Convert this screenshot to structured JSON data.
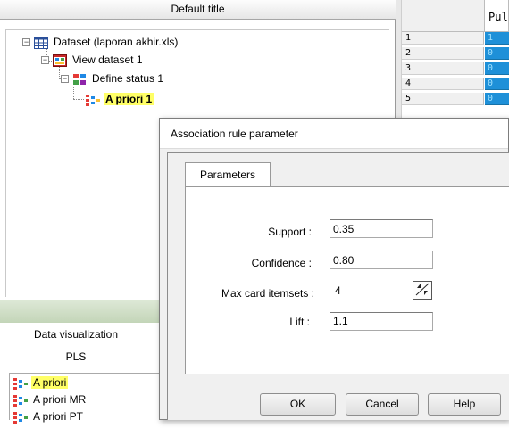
{
  "tree_panel": {
    "header": "Default title",
    "nodes": [
      {
        "label": "Dataset (laporan akhir.xls)",
        "expander": "−"
      },
      {
        "label": "View dataset 1",
        "expander": "−"
      },
      {
        "label": "Define status 1",
        "expander": "−"
      },
      {
        "label": "A priori 1",
        "highlighted": true
      }
    ]
  },
  "grid": {
    "column_header": "Pul",
    "rows": [
      {
        "num": "1",
        "value": "1"
      },
      {
        "num": "2",
        "value": "0"
      },
      {
        "num": "3",
        "value": "0"
      },
      {
        "num": "4",
        "value": "0"
      },
      {
        "num": "5",
        "value": "0"
      }
    ]
  },
  "bottom_panel": {
    "section_title": "Data visualization",
    "subsection": "PLS",
    "methods": [
      {
        "label": "A priori",
        "highlighted": true
      },
      {
        "label": "A priori MR"
      },
      {
        "label": "A priori PT"
      }
    ]
  },
  "dialog": {
    "title": "Association rule parameter",
    "tab": "Parameters",
    "fields": {
      "support": {
        "label": "Support :",
        "value": "0.35"
      },
      "confidence": {
        "label": "Confidence :",
        "value": "0.80"
      },
      "max_card": {
        "label": "Max card itemsets :",
        "value": "4"
      },
      "lift": {
        "label": "Lift :",
        "value": "1.1"
      }
    },
    "buttons": {
      "ok": "OK",
      "cancel": "Cancel",
      "help": "Help"
    }
  },
  "colors": {
    "highlight": "#ffff66",
    "grid_cell": "#1e90d8",
    "grid_text": "#9fe1ff"
  },
  "icons": {
    "dataset": "table-icon",
    "view": "view-dataset-icon",
    "status": "define-status-icon",
    "apriori": "association-rule-icon"
  }
}
